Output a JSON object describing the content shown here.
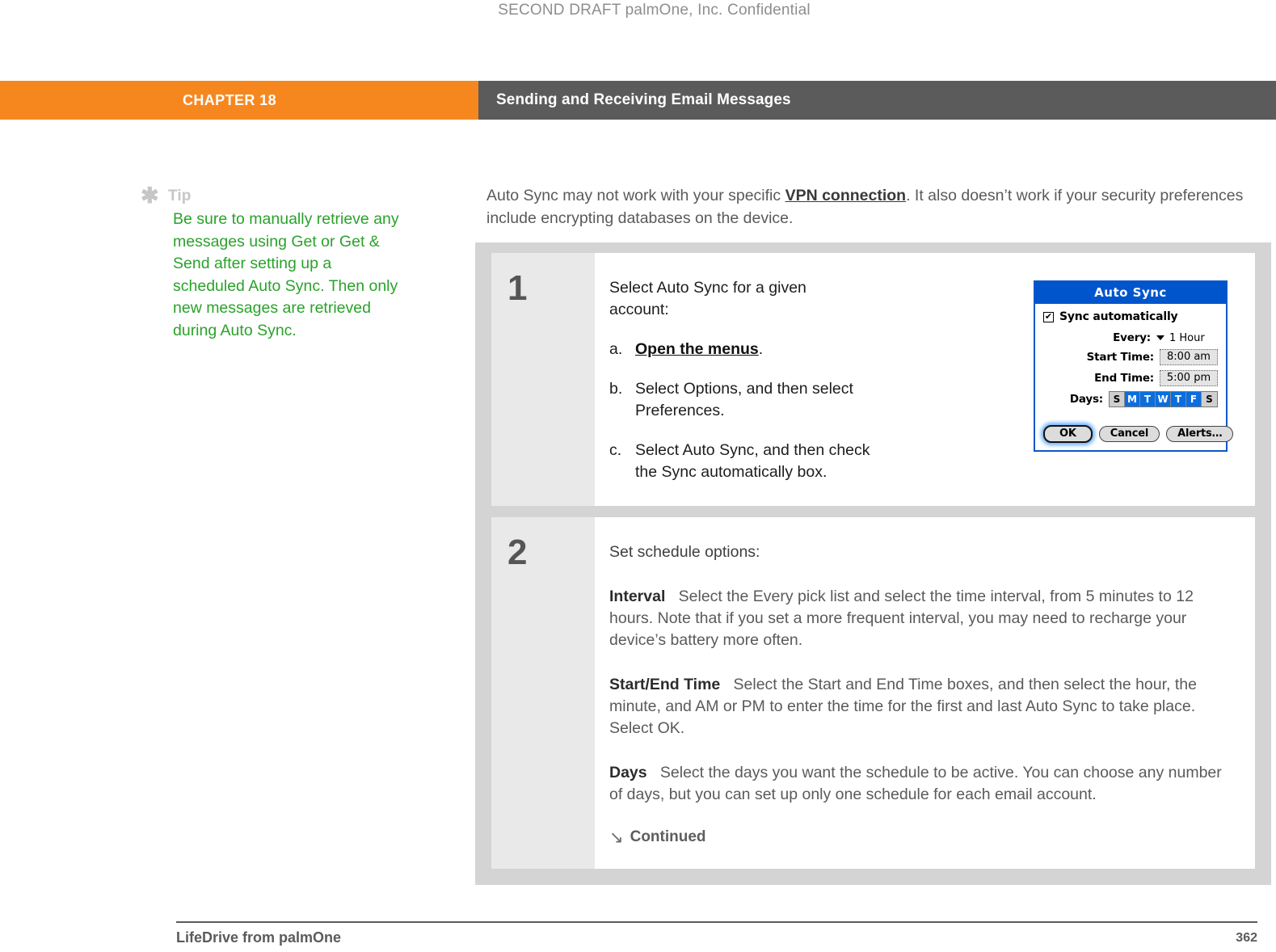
{
  "draft_header": "SECOND DRAFT palmOne, Inc.  Confidential",
  "chapter_bar": {
    "chapter_label": "CHAPTER 18",
    "chapter_title": "Sending and Receiving Email Messages",
    "orange_hex": "#f6871f",
    "gray_hex": "#5b5b5b"
  },
  "tip": {
    "icon": "asterisk-icon",
    "title": "Tip",
    "body": "Be sure to manually retrieve any messages using Get or Get & Send after setting up a scheduled Auto Sync. Then only new messages are retrieved during Auto Sync.",
    "text_color": "#2aa22a"
  },
  "intro": {
    "part1": "Auto Sync may not work with your specific ",
    "link": "VPN connection",
    "part2": ". It also doesn’t work if your security preferences include encrypting databases on the device."
  },
  "steps": [
    {
      "number": "1",
      "lead": "Select Auto Sync for a given account:",
      "substeps": [
        {
          "letter": "a.",
          "pre": "",
          "link": "Open the menus",
          "post": "."
        },
        {
          "letter": "b.",
          "pre": "Select Options, and then select Preferences.",
          "link": "",
          "post": ""
        },
        {
          "letter": "c.",
          "pre": "Select Auto Sync, and then check the Sync automatically box.",
          "link": "",
          "post": ""
        }
      ]
    },
    {
      "number": "2",
      "lead": "Set schedule options:",
      "paragraphs": [
        {
          "term": "Interval",
          "text": "Select the Every pick list and select the time interval, from 5 minutes to 12 hours. Note that if you set a more frequent interval, you may need to recharge your device’s battery more often."
        },
        {
          "term": "Start/End Time",
          "text": "Select the Start and End Time boxes, and then select the hour, the minute, and AM or PM to enter the time for the first and last Auto Sync to take place. Select OK."
        },
        {
          "term": "Days",
          "text": "Select the days you want the schedule to be active. You can choose any number of days, but you can set up only one schedule for each email account."
        }
      ],
      "continued_arrow": "↘",
      "continued_label": "Continued"
    }
  ],
  "dialog": {
    "title": "Auto Sync",
    "title_bar_hex": "#0055cc",
    "checkbox": {
      "checked": true,
      "glyph": "✔",
      "label": "Sync automatically"
    },
    "fields": [
      {
        "label": "Every:",
        "value": "1 Hour",
        "style": "picklist"
      },
      {
        "label": "Start Time:",
        "value": "8:00 am",
        "style": "box"
      },
      {
        "label": "End Time:",
        "value": "5:00 pm",
        "style": "box"
      }
    ],
    "days_label": "Days:",
    "days": [
      {
        "letter": "S",
        "selected": false
      },
      {
        "letter": "M",
        "selected": true
      },
      {
        "letter": "T",
        "selected": true
      },
      {
        "letter": "W",
        "selected": true
      },
      {
        "letter": "T",
        "selected": true
      },
      {
        "letter": "F",
        "selected": true
      },
      {
        "letter": "S",
        "selected": false
      }
    ],
    "selected_day_hex": "#0b6ee0",
    "buttons": [
      {
        "label": "OK",
        "primary": true
      },
      {
        "label": "Cancel",
        "primary": false
      },
      {
        "label": "Alerts…",
        "primary": false
      }
    ]
  },
  "footer": {
    "left": "LifeDrive from palmOne",
    "page_number": "362"
  }
}
